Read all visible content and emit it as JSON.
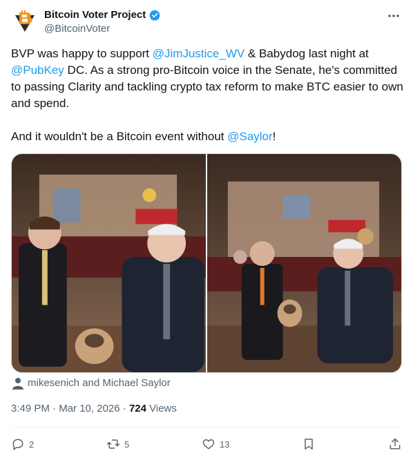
{
  "author": {
    "name": "Bitcoin Voter Project",
    "handle": "@BitcoinVoter",
    "verified": true
  },
  "tweet": {
    "p1_a": "BVP was happy to support ",
    "mention_jim": "@JimJustice_WV",
    "p1_b": " & Babydog last night at ",
    "mention_pubkey": "@PubKey",
    "p1_c": " DC. As a strong pro-Bitcoin voice in the Senate, he's committed to passing Clarity and tackling crypto tax reform to make BTC easier to own and spend.",
    "p2_a": "And it wouldn't be a Bitcoin event without ",
    "mention_saylor": "@Saylor",
    "p2_b": "!"
  },
  "tagged": "mikesenich and Michael Saylor",
  "meta": {
    "time": "3:49 PM",
    "sep": " · ",
    "date": "Mar 10, 2026",
    "views_count": "724",
    "views_label": " Views"
  },
  "actions": {
    "replies": "2",
    "reposts": "5",
    "likes": "13"
  },
  "colors": {
    "accent": "#1d9bf0",
    "text": "#0f1419",
    "muted": "#536471",
    "logo_orange": "#f7931a"
  },
  "icons": [
    "bitcoin-logo-icon",
    "verified-badge-icon",
    "more-icon",
    "person-icon",
    "reply-icon",
    "repost-icon",
    "like-icon",
    "bookmark-icon",
    "share-icon"
  ]
}
